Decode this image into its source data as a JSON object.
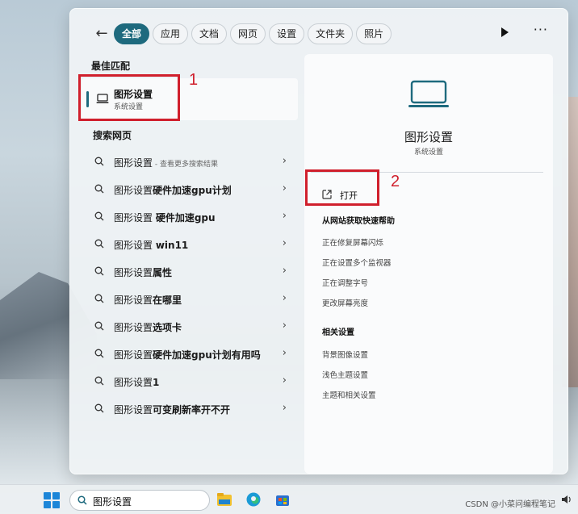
{
  "filters": {
    "items": [
      "全部",
      "应用",
      "文档",
      "网页",
      "设置",
      "文件夹",
      "照片"
    ],
    "active_index": 0
  },
  "left": {
    "best_match_heading": "最佳匹配",
    "best_match": {
      "title": "图形设置",
      "subtitle": "系统设置"
    },
    "web_heading": "搜索网页",
    "results": [
      {
        "prefix": "图形设置",
        "bold": "",
        "sub": " - 查看更多搜索结果"
      },
      {
        "prefix": "图形设置",
        "bold": "硬件加速gpu计划",
        "sub": ""
      },
      {
        "prefix": "图形设置 ",
        "bold": "硬件加速gpu",
        "sub": ""
      },
      {
        "prefix": "图形设置 ",
        "bold": "win11",
        "sub": ""
      },
      {
        "prefix": "图形设置",
        "bold": "属性",
        "sub": ""
      },
      {
        "prefix": "图形设置",
        "bold": "在哪里",
        "sub": ""
      },
      {
        "prefix": "图形设置",
        "bold": "选项卡",
        "sub": ""
      },
      {
        "prefix": "图形设置",
        "bold": "硬件加速gpu计划有用吗",
        "sub": ""
      },
      {
        "prefix": "图形设置",
        "bold": "1",
        "sub": ""
      },
      {
        "prefix": "图形设置",
        "bold": "可变刷新率开不开",
        "sub": ""
      }
    ]
  },
  "detail": {
    "title": "图形设置",
    "subtitle": "系统设置",
    "open_label": "打开",
    "help_heading": "从网站获取快速帮助",
    "help_links": [
      "正在修复屏幕闪烁",
      "正在设置多个监视器",
      "正在调整字号",
      "更改屏幕亮度"
    ],
    "related_heading": "相关设置",
    "related_links": [
      "背景图像设置",
      "浅色主题设置",
      "主题和相关设置"
    ]
  },
  "annotations": {
    "box1": "1",
    "box2": "2",
    "color": "#d01f2c"
  },
  "taskbar": {
    "search_value": "图形设置",
    "watermark": "CSDN @小菜问编程笔记"
  },
  "colors": {
    "accent": "#1e6a7e",
    "start_blue": "#1d86d8"
  }
}
